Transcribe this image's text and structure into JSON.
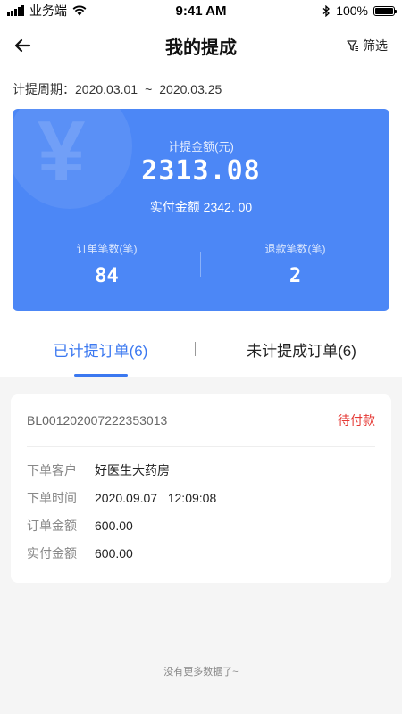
{
  "status_bar": {
    "carrier": "业务端",
    "time": "9:41 AM",
    "battery": "100%"
  },
  "header": {
    "title": "我的提成",
    "filter_label": "筛选"
  },
  "period": {
    "label": "计提周期：",
    "start": "2020.03.01",
    "separator": "~",
    "end": "2020.03.25"
  },
  "summary": {
    "amount_label": "计提金额(元)",
    "amount": "2313.08",
    "paid_text": "实付金额 2342. 00",
    "stats": [
      {
        "label": "订单笔数(笔)",
        "value": "84"
      },
      {
        "label": "退款笔数(笔)",
        "value": "2"
      }
    ]
  },
  "tabs": [
    {
      "label": "已计提订单(6)",
      "active": true
    },
    {
      "label": "未计提成订单(6)",
      "active": false
    }
  ],
  "orders": [
    {
      "order_no": "BL001202007222353013",
      "status": "待付款",
      "fields": [
        {
          "key": "下单客户",
          "value": "好医生大药房"
        },
        {
          "key": "下单时间",
          "value": "2020.09.07   12:09:08"
        },
        {
          "key": "订单金额",
          "value": "600.00"
        },
        {
          "key": "实付金额",
          "value": "600.00"
        }
      ]
    }
  ],
  "footer": {
    "no_more": "没有更多数据了~"
  },
  "colors": {
    "accent": "#4c87f6",
    "tab_active": "#3b78f0",
    "status_red": "#e53935"
  },
  "icons": {
    "back": "arrow-left-icon",
    "filter": "funnel-icon",
    "wifi": "wifi-icon",
    "bluetooth": "bluetooth-icon",
    "battery": "battery-icon"
  }
}
